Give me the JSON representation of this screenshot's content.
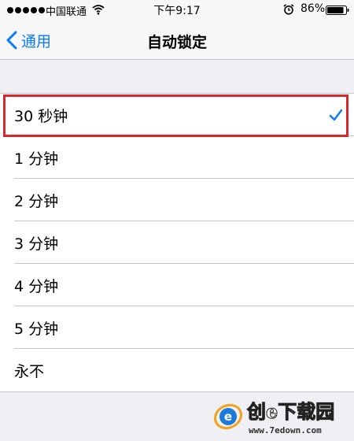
{
  "status_bar": {
    "carrier": "中国联通",
    "time": "下午9:17",
    "battery_percent": "86%"
  },
  "nav": {
    "back_label": "通用",
    "title": "自动锁定"
  },
  "list": {
    "items": [
      {
        "label": "30 秒钟",
        "selected": true
      },
      {
        "label": "1 分钟",
        "selected": false
      },
      {
        "label": "2 分钟",
        "selected": false
      },
      {
        "label": "3 分钟",
        "selected": false
      },
      {
        "label": "4 分钟",
        "selected": false
      },
      {
        "label": "5 分钟",
        "selected": false
      },
      {
        "label": "永不",
        "selected": false
      }
    ]
  },
  "watermark": {
    "brand": "创e下载园",
    "url": "www.7edown.com"
  },
  "colors": {
    "accent": "#0a7aff",
    "highlight": "#d9272e",
    "background": "#efeff4"
  }
}
